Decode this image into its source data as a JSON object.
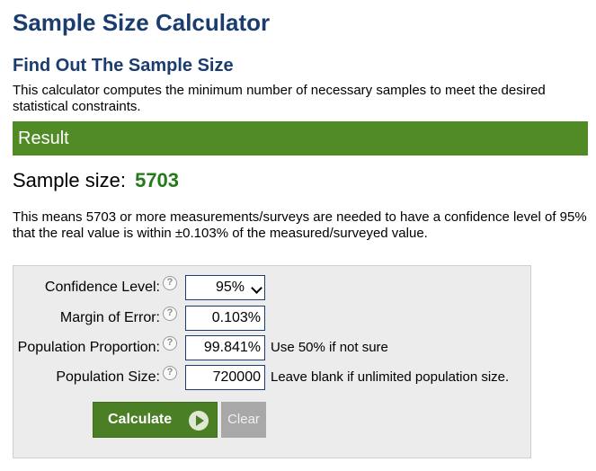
{
  "page": {
    "title": "Sample Size Calculator",
    "subtitle": "Find Out The Sample Size",
    "description": "This calculator computes the minimum number of necessary samples to meet the desired statistical constraints."
  },
  "result": {
    "header": "Result",
    "sample_size_label": "Sample size:",
    "sample_size_value": "5703",
    "explanation": "This means 5703 or more measurements/surveys are needed to have a confidence level of 95% that the real value is within ±0.103% of the measured/surveyed value."
  },
  "form": {
    "confidence_level": {
      "label": "Confidence Level:",
      "value": "95%"
    },
    "margin_of_error": {
      "label": "Margin of Error:",
      "value": "0.103",
      "unit": "%"
    },
    "population_proportion": {
      "label": "Population Proportion:",
      "value": "99.841",
      "unit": "%",
      "note": "Use 50% if not sure"
    },
    "population_size": {
      "label": "Population Size:",
      "value": "720000",
      "note": "Leave blank if unlimited population size."
    },
    "help_glyph": "?",
    "calculate_label": "Calculate",
    "clear_label": "Clear"
  },
  "colors": {
    "heading": "#1a3c6e",
    "result_bar": "#518b25",
    "result_value": "#237a1a",
    "button_calculate": "#4a7f26",
    "button_clear": "#a8a8a8"
  }
}
